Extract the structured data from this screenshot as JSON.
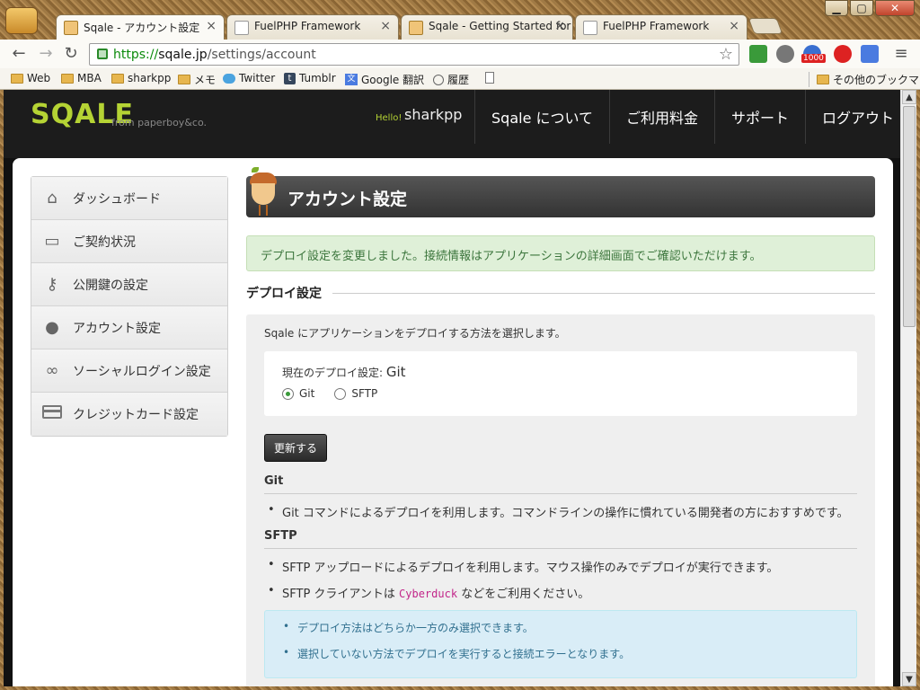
{
  "browser": {
    "tabs": [
      {
        "title": "Sqale - アカウント設定",
        "active": true,
        "favicon": "sqale-favicon"
      },
      {
        "title": "FuelPHP Framework",
        "active": false,
        "favicon": "page-favicon"
      },
      {
        "title": "Sqale - Getting Started for",
        "active": false,
        "favicon": "sqale-favicon"
      },
      {
        "title": "FuelPHP Framework",
        "active": false,
        "favicon": "page-favicon"
      }
    ],
    "url_scheme": "https://",
    "url_host": "sqale.jp",
    "url_path": "/settings/account",
    "badge_count": "1000",
    "bookmarks": [
      {
        "label": "Web",
        "icon": "folder-icon"
      },
      {
        "label": "MBA",
        "icon": "folder-icon"
      },
      {
        "label": "sharkpp",
        "icon": "folder-icon"
      },
      {
        "label": "メモ",
        "icon": "folder-icon"
      },
      {
        "label": "Twitter",
        "icon": "twitter-icon"
      },
      {
        "label": "Tumblr",
        "icon": "tumblr-icon"
      },
      {
        "label": "Google 翻訳",
        "icon": "google-translate-icon"
      },
      {
        "label": "履歴",
        "icon": "history-icon"
      },
      {
        "label": "",
        "icon": "page-icon"
      }
    ],
    "other_bookmarks": "その他のブックマーク"
  },
  "site": {
    "logo": "SQALE",
    "logo_sub": "from paperboy&co.",
    "hello": "Hello!",
    "username": "sharkpp",
    "nav": [
      "Sqale について",
      "ご利用料金",
      "サポート",
      "ログアウト"
    ]
  },
  "sidebar": {
    "items": [
      {
        "label": "ダッシュボード",
        "icon": "home-icon"
      },
      {
        "label": "ご契約状況",
        "icon": "money-icon"
      },
      {
        "label": "公開鍵の設定",
        "icon": "key-icon"
      },
      {
        "label": "アカウント設定",
        "icon": "user-icon"
      },
      {
        "label": "ソーシャルログイン設定",
        "icon": "link-icon"
      },
      {
        "label": "クレジットカード設定",
        "icon": "credit-card-icon"
      }
    ]
  },
  "main": {
    "title": "アカウント設定",
    "flash": "デプロイ設定を変更しました。接続情報はアプリケーションの詳細画面でご確認いただけます。",
    "section": "デプロイ設定",
    "intro": "Sqale にアプリケーションをデプロイする方法を選択します。",
    "current_label": "現在のデプロイ設定: ",
    "current_value": "Git",
    "options": [
      "Git",
      "SFTP"
    ],
    "selected": "Git",
    "update_button": "更新する",
    "git_heading": "Git",
    "git_items": [
      "Git コマンドによるデプロイを利用します。コマンドラインの操作に慣れている開発者の方におすすめです。"
    ],
    "sftp_heading": "SFTP",
    "sftp_items": [
      "SFTP アップロードによるデプロイを利用します。マウス操作のみでデプロイが実行できます。"
    ],
    "sftp_client_before": "SFTP クライアントは ",
    "sftp_client_link": "Cyberduck",
    "sftp_client_after": " などをご利用ください。",
    "info_items": [
      "デプロイ方法はどちらか一方のみ選択できます。",
      "選択していない方法でデプロイを実行すると接続エラーとなります。"
    ]
  }
}
